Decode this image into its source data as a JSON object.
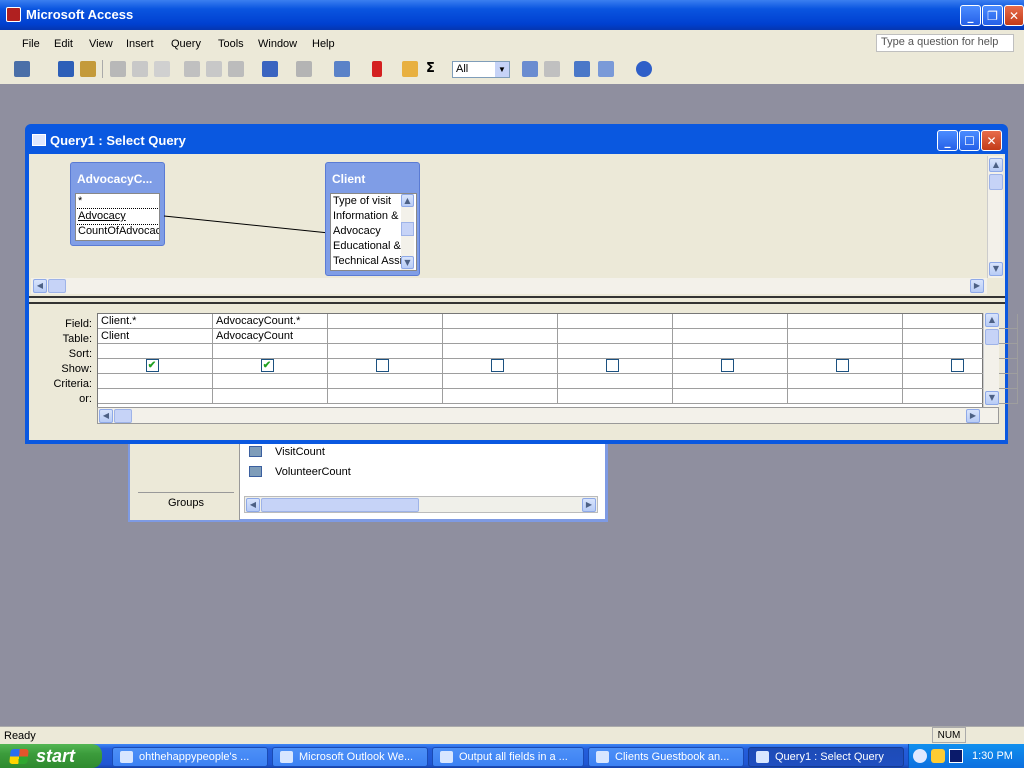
{
  "app": {
    "title": "Microsoft Access"
  },
  "menu": {
    "items": [
      {
        "label": "File"
      },
      {
        "label": "Edit"
      },
      {
        "label": "View"
      },
      {
        "label": "Insert"
      },
      {
        "label": "Query"
      },
      {
        "label": "Tools"
      },
      {
        "label": "Window"
      },
      {
        "label": "Help"
      }
    ],
    "ask_placeholder": "Type a question for help"
  },
  "toolbar": {
    "topvalues": "All"
  },
  "dbwindow": {
    "groups_label": "Groups",
    "items": [
      {
        "label": "VisitCount"
      },
      {
        "label": "VolunteerCount"
      }
    ]
  },
  "query_window": {
    "title": "Query1 : Select Query",
    "tables": [
      {
        "name": "AdvocacyC...",
        "fields": [
          "*",
          "Advocacy",
          "CountOfAdvocac"
        ]
      },
      {
        "name": "Client",
        "fields": [
          "Type of visit",
          "Information &",
          "Advocacy",
          "Educational &",
          "Technical Assi"
        ]
      }
    ],
    "row_labels": {
      "field": "Field:",
      "table": "Table:",
      "sort": "Sort:",
      "show": "Show:",
      "criteria": "Criteria:",
      "or": "or:"
    },
    "columns": [
      {
        "field": "Client.*",
        "table": "Client",
        "show": true
      },
      {
        "field": "AdvocacyCount.*",
        "table": "AdvocacyCount",
        "show": true
      },
      {
        "field": "",
        "table": "",
        "show": false
      },
      {
        "field": "",
        "table": "",
        "show": false
      },
      {
        "field": "",
        "table": "",
        "show": false
      },
      {
        "field": "",
        "table": "",
        "show": false
      },
      {
        "field": "",
        "table": "",
        "show": false
      },
      {
        "field": "",
        "table": "",
        "show": false
      }
    ]
  },
  "status": {
    "text": "Ready",
    "num": "NUM"
  },
  "taskbar": {
    "start": "start",
    "tasks": [
      {
        "label": "ohthehappypeople's ..."
      },
      {
        "label": "Microsoft Outlook We..."
      },
      {
        "label": "Output all fields in a ..."
      },
      {
        "label": "Clients Guestbook an..."
      },
      {
        "label": "Query1 : Select Query"
      }
    ],
    "clock": "1:30 PM"
  }
}
